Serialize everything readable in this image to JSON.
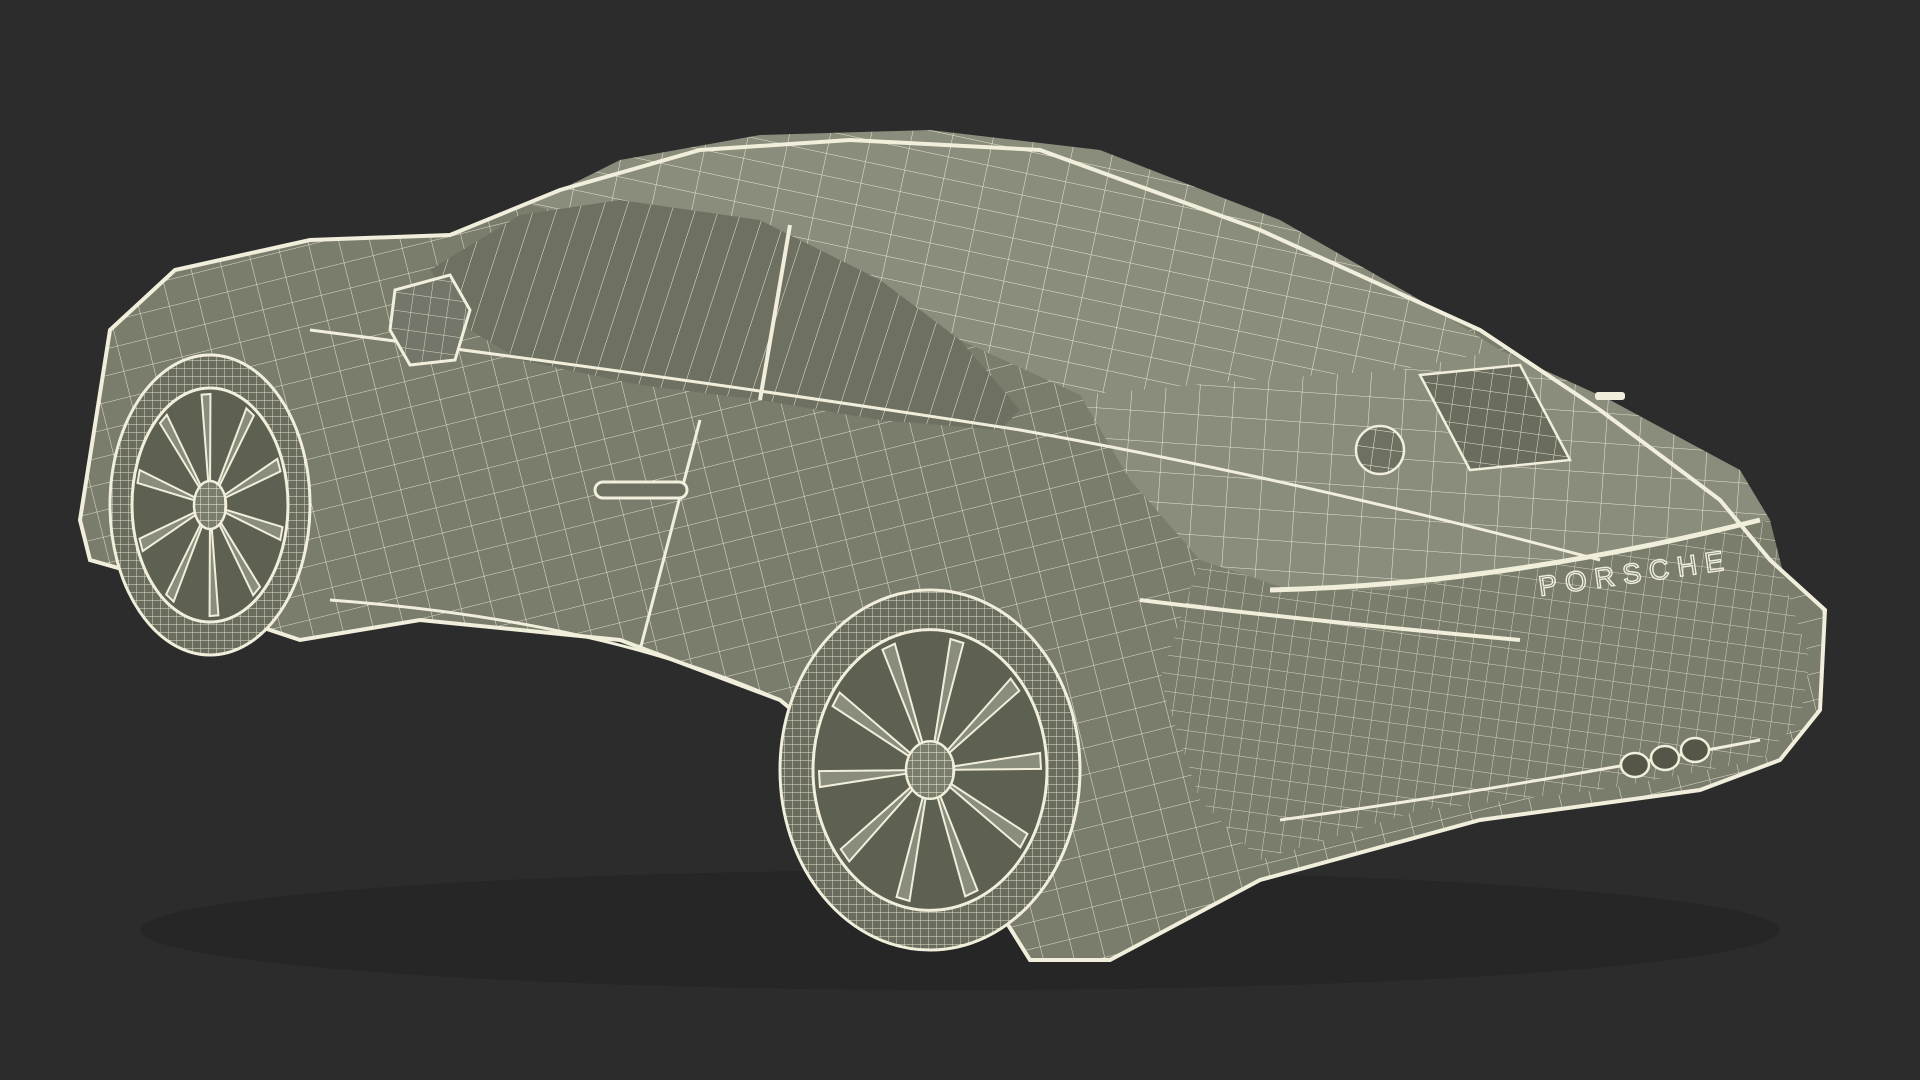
{
  "viewport": {
    "background": "#2c2c2c",
    "render_style": "wireframe-shaded"
  },
  "model": {
    "subject": "sports-coupe",
    "view": "rear-three-quarter",
    "body_fill": "#7a7c6c",
    "body_fill_light": "#8a8c7c",
    "body_fill_dark": "#5e6052",
    "wire_color": "#f1efdc",
    "glass_fill": "#6e7062",
    "tire_fill": "#6a6c5e",
    "rear_badge_text": "PORSCHE"
  }
}
